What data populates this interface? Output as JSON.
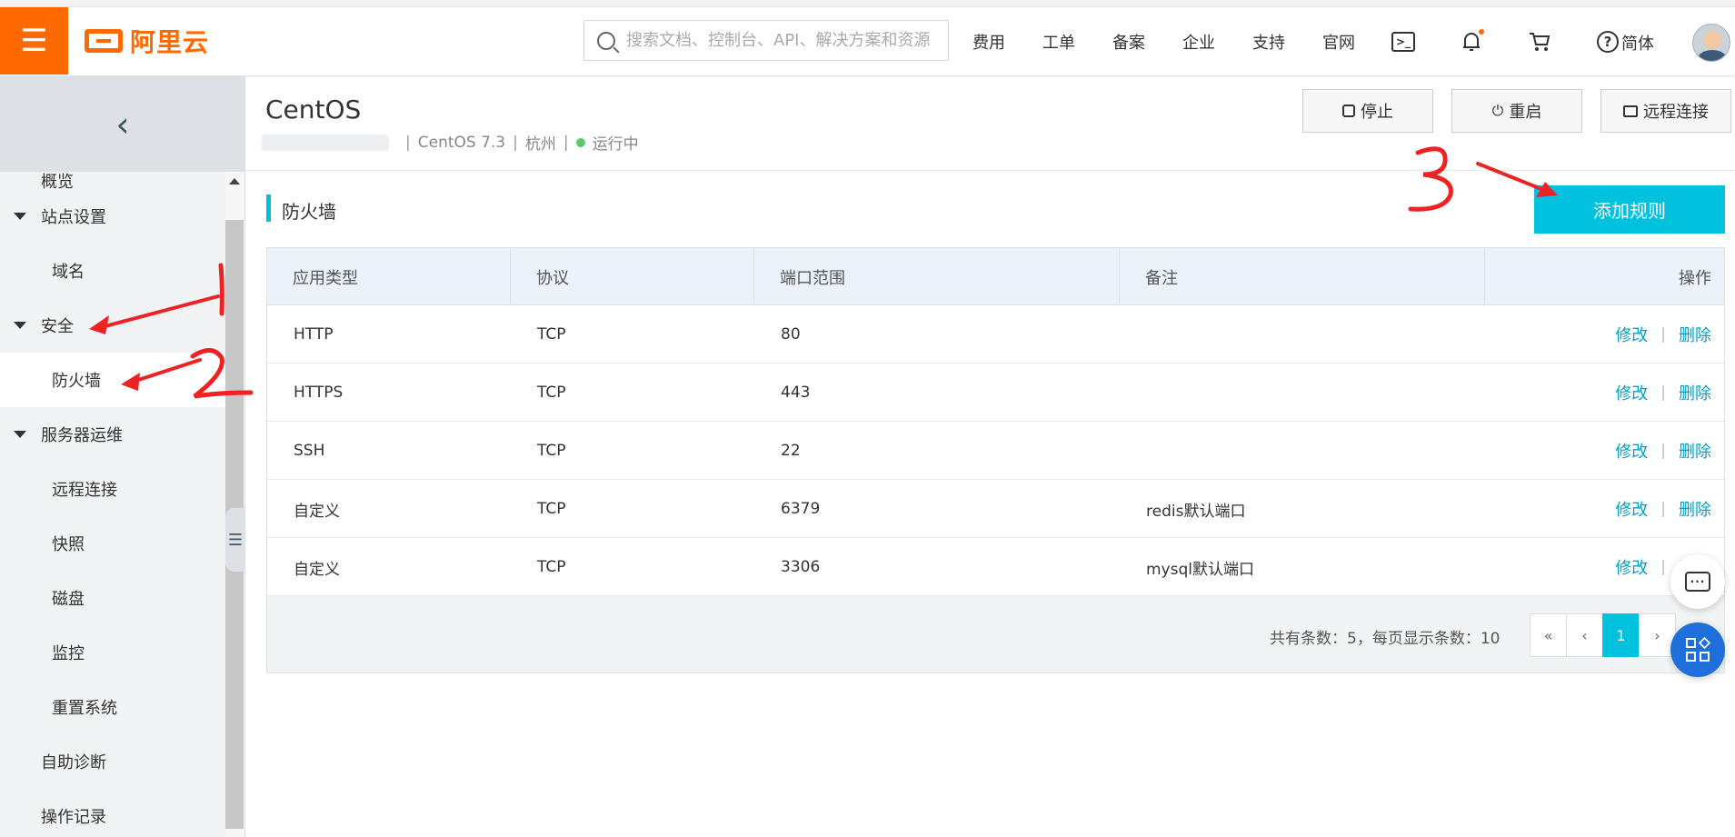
{
  "topbar": {
    "menu_glyph": "☰",
    "logo_text": "阿里云",
    "search_placeholder": "搜索文档、控制台、API、解决方案和资源",
    "nav": [
      "费用",
      "工单",
      "备案",
      "企业",
      "支持",
      "官网"
    ],
    "icons": [
      "terminal-icon",
      "bell-icon",
      "cart-icon",
      "help-icon"
    ],
    "language": "简体"
  },
  "sidebar": {
    "collapse_glyph": "‹",
    "items": [
      {
        "label": "概览",
        "kind": "sub"
      },
      {
        "label": "站点设置",
        "kind": "group"
      },
      {
        "label": "域名",
        "kind": "sub"
      },
      {
        "label": "安全",
        "kind": "group"
      },
      {
        "label": "防火墙",
        "kind": "sub",
        "active": true
      },
      {
        "label": "服务器运维",
        "kind": "group"
      },
      {
        "label": "远程连接",
        "kind": "sub"
      },
      {
        "label": "快照",
        "kind": "sub"
      },
      {
        "label": "磁盘",
        "kind": "sub"
      },
      {
        "label": "监控",
        "kind": "sub"
      },
      {
        "label": "重置系统",
        "kind": "sub"
      },
      {
        "label": "自助诊断",
        "kind": "plain"
      },
      {
        "label": "操作记录",
        "kind": "plain"
      }
    ]
  },
  "header": {
    "title": "CentOS",
    "os": "CentOS 7.3",
    "region": "杭州",
    "status": "运行中",
    "separator": "|",
    "buttons": {
      "stop": "停止",
      "restart": "重启",
      "remote": "远程连接"
    }
  },
  "firewall": {
    "section_title": "防火墙",
    "add_button": "添加规则",
    "columns": [
      "应用类型",
      "协议",
      "端口范围",
      "备注",
      "操作"
    ],
    "rows": [
      {
        "type": "HTTP",
        "protocol": "TCP",
        "port": "80",
        "note": ""
      },
      {
        "type": "HTTPS",
        "protocol": "TCP",
        "port": "443",
        "note": ""
      },
      {
        "type": "SSH",
        "protocol": "TCP",
        "port": "22",
        "note": ""
      },
      {
        "type": "自定义",
        "protocol": "TCP",
        "port": "6379",
        "note": "redis默认端口"
      },
      {
        "type": "自定义",
        "protocol": "TCP",
        "port": "3306",
        "note": "mysql默认端口"
      }
    ],
    "op_edit": "修改",
    "op_delete": "删除",
    "op_sep": "|",
    "total_text": "共有条数：5，每页显示条数：10",
    "pager": [
      "«",
      "‹",
      "1",
      "›"
    ],
    "current_page": "1"
  },
  "colors": {
    "brand": "#ff6a00",
    "accent": "#00c1de",
    "link": "#00a2ca",
    "annotation": "#ee2222"
  }
}
